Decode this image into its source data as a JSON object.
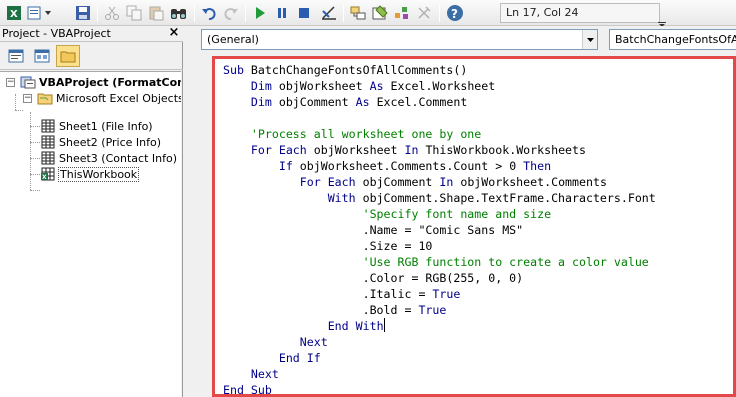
{
  "toolbar": {
    "buttons": [
      {
        "name": "excel-icon",
        "enabled": true
      },
      {
        "name": "insert-module-icon",
        "enabled": true
      },
      {
        "name": "save-icon",
        "enabled": true
      },
      {
        "name": "cut-icon",
        "enabled": false
      },
      {
        "name": "copy-icon",
        "enabled": false
      },
      {
        "name": "paste-icon",
        "enabled": false
      },
      {
        "name": "find-icon",
        "enabled": true
      },
      {
        "name": "undo-icon",
        "enabled": true
      },
      {
        "name": "redo-icon",
        "enabled": false
      },
      {
        "name": "run-icon",
        "enabled": true
      },
      {
        "name": "break-icon",
        "enabled": true
      },
      {
        "name": "reset-icon",
        "enabled": true
      },
      {
        "name": "design-mode-icon",
        "enabled": true
      },
      {
        "name": "project-explorer-icon",
        "enabled": true
      },
      {
        "name": "properties-icon",
        "enabled": true
      },
      {
        "name": "object-browser-icon",
        "enabled": true
      },
      {
        "name": "toolbox-icon",
        "enabled": false
      },
      {
        "name": "help-icon",
        "enabled": true
      }
    ],
    "status": "Ln 17, Col 24"
  },
  "project_panel": {
    "title": "Project - VBAProject",
    "close": "×",
    "tools": [
      "view-code-icon",
      "view-object-icon",
      "toggle-folders-icon"
    ],
    "tree": [
      {
        "label": "VBAProject (FormatComments.xlsm)",
        "level": 0,
        "icon": "vba-project-icon",
        "expander": "−"
      },
      {
        "label": "Microsoft Excel Objects",
        "level": 1,
        "icon": "folder-icon",
        "expander": "−"
      },
      {
        "label": "Sheet1 (File Info)",
        "level": 2,
        "icon": "worksheet-icon"
      },
      {
        "label": "Sheet2 (Price Info)",
        "level": 2,
        "icon": "worksheet-icon"
      },
      {
        "label": "Sheet3 (Contact Info)",
        "level": 2,
        "icon": "worksheet-icon"
      },
      {
        "label": "ThisWorkbook",
        "level": 2,
        "icon": "workbook-icon",
        "selected": true
      }
    ]
  },
  "code_window": {
    "object_combo": "(General)",
    "procedure_combo": "BatchChangeFontsOfAllComments",
    "lines": [
      [
        {
          "t": "Sub ",
          "c": "kw"
        },
        {
          "t": "BatchChangeFontsOfAllComments()",
          "c": ""
        }
      ],
      [
        {
          "t": "    ",
          "c": ""
        },
        {
          "t": "Dim ",
          "c": "kw"
        },
        {
          "t": "objWorksheet ",
          "c": ""
        },
        {
          "t": "As ",
          "c": "kw"
        },
        {
          "t": "Excel.Worksheet",
          "c": ""
        }
      ],
      [
        {
          "t": "    ",
          "c": ""
        },
        {
          "t": "Dim ",
          "c": "kw"
        },
        {
          "t": "objComment ",
          "c": ""
        },
        {
          "t": "As ",
          "c": "kw"
        },
        {
          "t": "Excel.Comment",
          "c": ""
        }
      ],
      [],
      [
        {
          "t": "    'Process all worksheet one by one",
          "c": "cm"
        }
      ],
      [
        {
          "t": "    ",
          "c": ""
        },
        {
          "t": "For Each ",
          "c": "kw"
        },
        {
          "t": "objWorksheet ",
          "c": ""
        },
        {
          "t": "In ",
          "c": "kw"
        },
        {
          "t": "ThisWorkbook.Worksheets",
          "c": ""
        }
      ],
      [
        {
          "t": "        ",
          "c": ""
        },
        {
          "t": "If ",
          "c": "kw"
        },
        {
          "t": "objWorksheet.Comments.Count > 0 ",
          "c": ""
        },
        {
          "t": "Then",
          "c": "kw"
        }
      ],
      [
        {
          "t": "           ",
          "c": ""
        },
        {
          "t": "For Each ",
          "c": "kw"
        },
        {
          "t": "objComment ",
          "c": ""
        },
        {
          "t": "In ",
          "c": "kw"
        },
        {
          "t": "objWorksheet.Comments",
          "c": ""
        }
      ],
      [
        {
          "t": "               ",
          "c": ""
        },
        {
          "t": "With ",
          "c": "kw"
        },
        {
          "t": "objComment.Shape.TextFrame.Characters.Font",
          "c": ""
        }
      ],
      [
        {
          "t": "                    'Specify font name and size",
          "c": "cm"
        }
      ],
      [
        {
          "t": "                    .Name = \"Comic Sans MS\"",
          "c": ""
        }
      ],
      [
        {
          "t": "                    .Size = 10",
          "c": ""
        }
      ],
      [
        {
          "t": "                    'Use RGB function to create a color value",
          "c": "cm"
        }
      ],
      [
        {
          "t": "                    .Color = RGB(255, 0, 0)",
          "c": ""
        }
      ],
      [
        {
          "t": "                    .Italic = ",
          "c": ""
        },
        {
          "t": "True",
          "c": "kw"
        }
      ],
      [
        {
          "t": "                    .Bold = ",
          "c": ""
        },
        {
          "t": "True",
          "c": "kw"
        }
      ],
      [
        {
          "t": "               ",
          "c": ""
        },
        {
          "t": "End With",
          "c": "kw"
        },
        {
          "t": "",
          "c": "caret"
        }
      ],
      [
        {
          "t": "           ",
          "c": ""
        },
        {
          "t": "Next",
          "c": "kw"
        }
      ],
      [
        {
          "t": "        ",
          "c": ""
        },
        {
          "t": "End If",
          "c": "kw"
        }
      ],
      [
        {
          "t": "    ",
          "c": ""
        },
        {
          "t": "Next",
          "c": "kw"
        }
      ],
      [
        {
          "t": "End Sub",
          "c": "kw"
        }
      ]
    ]
  },
  "colors": {
    "keyword": "#00008b",
    "comment": "#008000",
    "highlight_border": "#e34949"
  }
}
